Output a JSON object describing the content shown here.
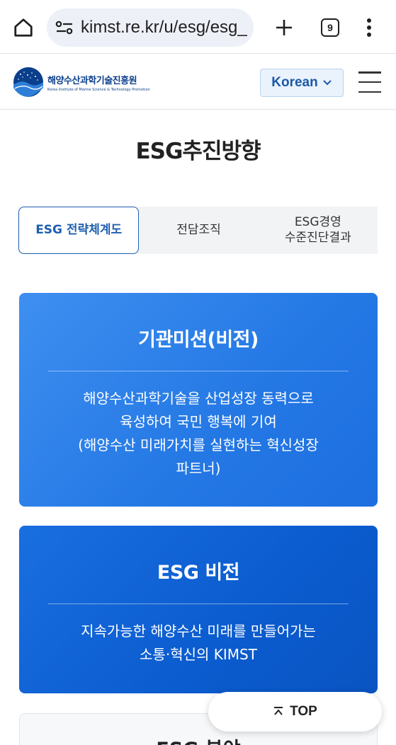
{
  "browser": {
    "url": "kimst.re.kr/u/esg/esg_",
    "tab_count": "9"
  },
  "header": {
    "logo_ko": "해양수산과학기술진흥원",
    "logo_en": "Korea Institute of Marine Science & Technology Promotion",
    "language": "Korean"
  },
  "page": {
    "title": "ESG추진방향"
  },
  "tabs": [
    {
      "label": "ESG 전략체계도",
      "active": true
    },
    {
      "label": "전담조직",
      "active": false
    },
    {
      "label_line1": "ESG경영",
      "label_line2": "수준진단결과",
      "active": false
    }
  ],
  "mission_card": {
    "title": "기관미션(비전)",
    "lines": [
      "해양수산과학기술을 산업성장 동력으로",
      "육성하여 국민 행복에 기여",
      "(해양수산 미래가치를 실현하는 혁신성장",
      "파트너)"
    ]
  },
  "vision_card": {
    "title": "ESG 비전",
    "lines": [
      "지속가능한 해양수산 미래를 만들어가는",
      "소통·혁신의 KIMST"
    ]
  },
  "next_card": {
    "title": "ESG 분야"
  },
  "top_button": {
    "label": "TOP"
  },
  "colors": {
    "accent": "#1f5fb0",
    "mission_bg": "#2f82ea",
    "vision_bg": "#0d5fd3"
  }
}
